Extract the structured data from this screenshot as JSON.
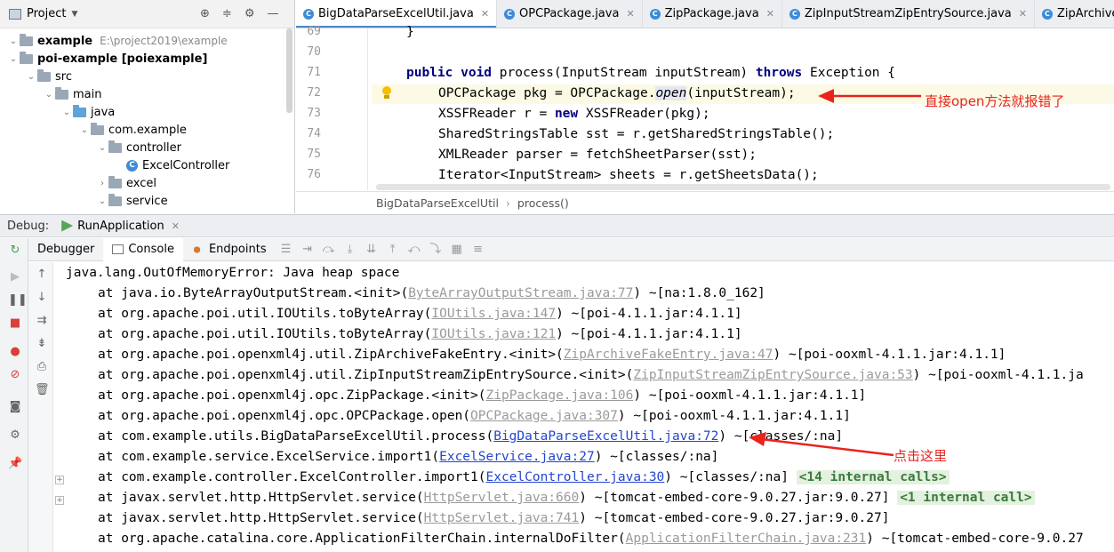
{
  "project": {
    "title": "Project",
    "tree": [
      {
        "label": "example",
        "path": "E:\\project2019\\example",
        "bold": true,
        "icon": "folder",
        "arrow": "down"
      },
      {
        "label": "poi-example [poiexample]",
        "bold": true,
        "icon": "folder",
        "arrow": "down"
      },
      {
        "label": "src",
        "icon": "folder",
        "arrow": "down"
      },
      {
        "label": "main",
        "icon": "folder",
        "arrow": "down"
      },
      {
        "label": "java",
        "icon": "folder-blue",
        "arrow": "down"
      },
      {
        "label": "com.example",
        "icon": "package",
        "arrow": "down"
      },
      {
        "label": "controller",
        "icon": "package",
        "arrow": "down"
      },
      {
        "label": "ExcelController",
        "icon": "class"
      },
      {
        "label": "excel",
        "icon": "package",
        "arrow": "right"
      },
      {
        "label": "service",
        "icon": "package",
        "arrow": "down"
      }
    ]
  },
  "editor": {
    "tabs": [
      {
        "label": "BigDataParseExcelUtil.java",
        "active": true
      },
      {
        "label": "OPCPackage.java"
      },
      {
        "label": "ZipPackage.java"
      },
      {
        "label": "ZipInputStreamZipEntrySource.java"
      },
      {
        "label": "ZipArchiveF"
      }
    ],
    "line_numbers": [
      "69",
      "70",
      "71",
      "72",
      "73",
      "74",
      "75",
      "76"
    ],
    "code": {
      "l69": "}",
      "l71_kw1": "public void",
      "l71_a": " process(InputStream inputStream) ",
      "l71_kw2": "throws",
      "l71_b": " Exception {",
      "l72_a": "OPCPackage pkg = OPCPackage.",
      "l72_method": "open",
      "l72_b": "(inputStream);",
      "l73_a": "XSSFReader r = ",
      "l73_kw": "new",
      "l73_b": " XSSFReader(pkg);",
      "l74": "SharedStringsTable sst = r.getSharedStringsTable();",
      "l75": "XMLReader parser = fetchSheetParser(sst);",
      "l76": "Iterator<InputStream> sheets = r.getSheetsData();"
    },
    "annotation": "直接open方法就报错了",
    "breadcrumb": [
      "BigDataParseExcelUtil",
      "process()"
    ]
  },
  "debug": {
    "label": "Debug:",
    "session": "RunApplication",
    "tabs": [
      "Debugger",
      "Console",
      "Endpoints"
    ],
    "annotation": "点击这里",
    "error_header": "java.lang.OutOfMemoryError: Java heap space",
    "frames": [
      {
        "prefix": "at java.io.ByteArrayOutputStream.<init>(",
        "link": "ByteArrayOutputStream.java:77",
        "suffix": ") ~[na:1.8.0_162]"
      },
      {
        "prefix": "at org.apache.poi.util.IOUtils.toByteArray(",
        "link": "IOUtils.java:147",
        "suffix": ") ~[poi-4.1.1.jar:4.1.1]"
      },
      {
        "prefix": "at org.apache.poi.util.IOUtils.toByteArray(",
        "link": "IOUtils.java:121",
        "suffix": ") ~[poi-4.1.1.jar:4.1.1]"
      },
      {
        "prefix": "at org.apache.poi.openxml4j.util.ZipArchiveFakeEntry.<init>(",
        "link": "ZipArchiveFakeEntry.java:47",
        "suffix": ") ~[poi-ooxml-4.1.1.jar:4.1.1]"
      },
      {
        "prefix": "at org.apache.poi.openxml4j.util.ZipInputStreamZipEntrySource.<init>(",
        "link": "ZipInputStreamZipEntrySource.java:53",
        "suffix": ") ~[poi-ooxml-4.1.1.ja"
      },
      {
        "prefix": "at org.apache.poi.openxml4j.opc.ZipPackage.<init>(",
        "link": "ZipPackage.java:106",
        "suffix": ") ~[poi-ooxml-4.1.1.jar:4.1.1]"
      },
      {
        "prefix": "at org.apache.poi.openxml4j.opc.OPCPackage.open(",
        "link": "OPCPackage.java:307",
        "suffix": ") ~[poi-ooxml-4.1.1.jar:4.1.1]"
      },
      {
        "prefix": "at com.example.utils.BigDataParseExcelUtil.process(",
        "link": "BigDataParseExcelUtil.java:72",
        "suffix": ") ~[classes/:na]",
        "live": true
      },
      {
        "prefix": "at com.example.service.ExcelService.import1(",
        "link": "ExcelService.java:27",
        "suffix": ") ~[classes/:na]",
        "live": true
      },
      {
        "prefix": "at com.example.controller.ExcelController.import1(",
        "link": "ExcelController.java:30",
        "suffix": ") ~[classes/:na] ",
        "live": true,
        "badge": "<14 internal calls>"
      },
      {
        "prefix": "at javax.servlet.http.HttpServlet.service(",
        "link": "HttpServlet.java:660",
        "suffix": ") ~[tomcat-embed-core-9.0.27.jar:9.0.27] ",
        "badge": "<1 internal call>"
      },
      {
        "prefix": "at javax.servlet.http.HttpServlet.service(",
        "link": "HttpServlet.java:741",
        "suffix": ") ~[tomcat-embed-core-9.0.27.jar:9.0.27]"
      },
      {
        "prefix": "at org.apache.catalina.core.ApplicationFilterChain.internalDoFilter(",
        "link": "ApplicationFilterChain.java:231",
        "suffix": ") ~[tomcat-embed-core-9.0.27"
      }
    ]
  },
  "colors": {
    "annotation": "#e8241c",
    "link_live": "#2446d0",
    "link_dim": "#9a9a9a",
    "keyword": "#000080"
  }
}
